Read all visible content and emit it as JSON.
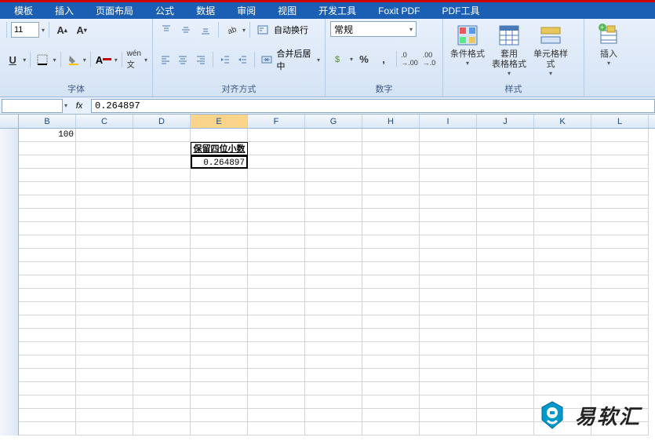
{
  "menubar": {
    "items": [
      "模板",
      "插入",
      "页面布局",
      "公式",
      "数据",
      "审阅",
      "视图",
      "开发工具",
      "Foxit PDF",
      "PDF工具"
    ]
  },
  "ribbon": {
    "font": {
      "size": "11",
      "group_label": "字体"
    },
    "align": {
      "wrap_label": "自动换行",
      "merge_label": "合并后居中",
      "group_label": "对齐方式"
    },
    "number": {
      "format": "常规",
      "group_label": "数字"
    },
    "styles": {
      "cond_format": "条件格式",
      "table_format": "套用\n表格格式",
      "cell_style": "单元格样式",
      "group_label": "样式"
    },
    "cells": {
      "insert": "插入"
    }
  },
  "formula_bar": {
    "name_box": "",
    "fx": "fx",
    "value": "0.264897"
  },
  "grid": {
    "columns": [
      "B",
      "C",
      "D",
      "E",
      "F",
      "G",
      "H",
      "I",
      "J",
      "K",
      "L"
    ],
    "b2": "100",
    "e3": "保留四位小数",
    "e4": "0.264897"
  },
  "watermark": {
    "text": "易软汇"
  }
}
